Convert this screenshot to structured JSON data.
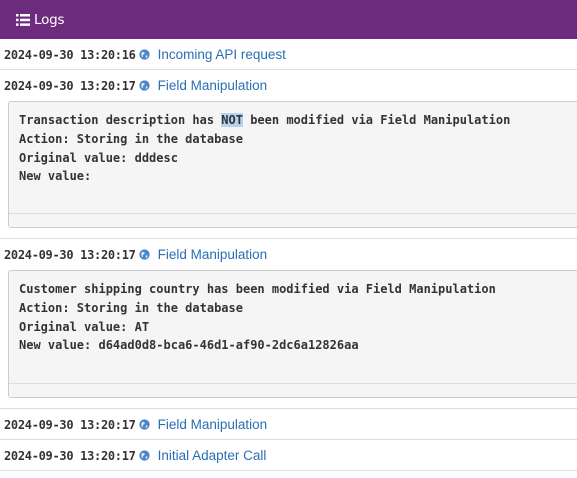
{
  "header": {
    "title": "Logs",
    "icon": "list-icon",
    "color": "#6c2b7c"
  },
  "entries": [
    {
      "timestamp": "2024-09-30 13:20:16",
      "label": "Incoming API request",
      "icon": "globe-icon"
    },
    {
      "timestamp": "2024-09-30 13:20:17",
      "label": "Field Manipulation",
      "icon": "globe-icon",
      "detail": {
        "line1_prefix": "Transaction description has ",
        "line1_highlight": "NOT",
        "line1_suffix": " been modified via Field Manipulation",
        "line2": "Action: Storing in the database",
        "line3": "Original value: dddesc",
        "line4": "New value:"
      }
    },
    {
      "timestamp": "2024-09-30 13:20:17",
      "label": "Field Manipulation",
      "icon": "globe-icon",
      "detail": {
        "line1": "Customer shipping country has been modified via Field Manipulation",
        "line2": "Action: Storing in the database",
        "line3": "Original value: AT",
        "line4": "New value: d64ad0d8-bca6-46d1-af90-2dc6a12826aa"
      }
    },
    {
      "timestamp": "2024-09-30 13:20:17",
      "label": "Field Manipulation",
      "icon": "globe-icon"
    },
    {
      "timestamp": "2024-09-30 13:20:17",
      "label": "Initial Adapter Call",
      "icon": "globe-icon"
    }
  ]
}
